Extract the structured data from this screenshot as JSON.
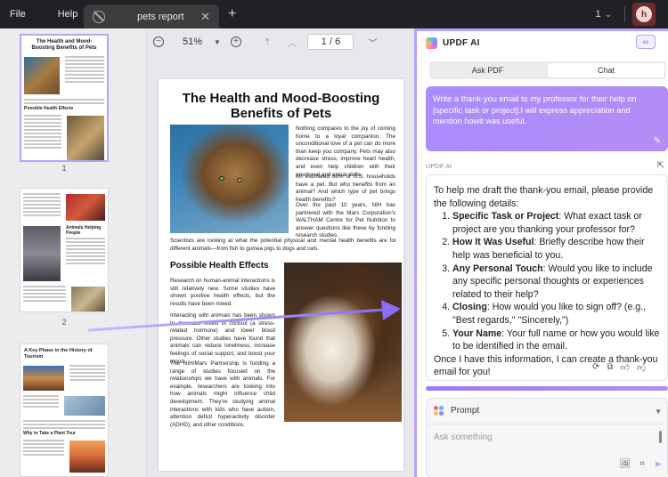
{
  "titlebar": {
    "menu_file": "File",
    "menu_help": "Help",
    "tab_title": "pets report",
    "tab_close": "✕",
    "new_tab": "+",
    "tabs_count": "1",
    "avatar_letter": "h"
  },
  "toolbar": {
    "zoom_out": "−",
    "zoom": "51%",
    "zoom_in": "+",
    "page_indicator": "1 / 6"
  },
  "thumbnails": {
    "page1_title": "The Health and Mood-Boosting Benefits of Pets",
    "page1_heading": "Possible Health Effects",
    "page1_num": "1",
    "page2_heading": "Animals Helping People",
    "page2_num": "2",
    "page3_title": "A Key Phase in the History of Tourism",
    "page3_heading": "Why to Take a Plant Tour"
  },
  "document": {
    "title": "The Health and Mood-Boosting Benefits of Pets",
    "para1": "Nothing compares to the joy of coming home to a loyal companion. The unconditional love of a pet can do more than keep you company. Pets may also decrease stress, improve heart health, and even help children with their emotional and social skills.",
    "para2": "An estimated 68% of U.S. households have a pet. But who benefits from an animal? And which type of pet brings health benefits?",
    "para3": "Over the past 10 years, NIH has partnered with the Mars Corporation's WALTHAM Centre for Pet Nutrition to answer questions like these by funding research studies.",
    "para4": "Scientists are looking at what the potential physical and mental health benefits are for different animals—from fish to guinea pigs to dogs and cats.",
    "heading2": "Possible Health Effects",
    "para5": "Research on human-animal interactions is still relatively new. Some studies have shown positive health effects, but the results have been mixed.",
    "para6": "Interacting with animals has been shown to decrease levels of cortisol (a stress-related hormone) and lower blood pressure. Other studies have found that animals can reduce loneliness, increase feelings of social support, and boost your mood.",
    "para7": "The NIH/Mars Partnership is funding a range of studies focused on the relationships we have with animals. For example, researchers are looking into how animals might influence child development. They're studying animal interactions with kids who have autism, attention deficit hyperactivity disorder (ADHD), and other conditions."
  },
  "ai_panel": {
    "title": "UPDF AI",
    "expand_icon": "∞",
    "tab_ask_pdf": "Ask PDF",
    "tab_chat": "Chat",
    "user_message": "Write a thank-you email to my professor for their help on [specific task or project].I will express appreciation and mention howit was useful.",
    "bot_name": "UPDF AI",
    "bot_intro": "To help me draft the thank-you email, please provide the following details:",
    "bot_items": [
      {
        "label": "Specific Task or Project",
        "text": ": What exact task or project are you thanking your professor for?"
      },
      {
        "label": "How It Was Useful",
        "text": ": Briefly describe how their help was beneficial to you."
      },
      {
        "label": "Any Personal Touch",
        "text": ": Would you like to include any specific personal thoughts or experiences related to their help?"
      },
      {
        "label": "Closing",
        "text": ": How would you like to sign off? (e.g., \"Best regards,\" \"Sincerely,\")"
      },
      {
        "label": "Your Name",
        "text": ": Your full name or how you would like to be identified in the email."
      }
    ],
    "bot_outro": "Once I have this information, I can create a thank-you email for you!",
    "prompt_label": "Prompt",
    "ask_placeholder": "Ask something"
  },
  "colors": {
    "accent": "#b7a0ff",
    "user_bubble": "#a98bff",
    "titlebar": "#202124"
  }
}
